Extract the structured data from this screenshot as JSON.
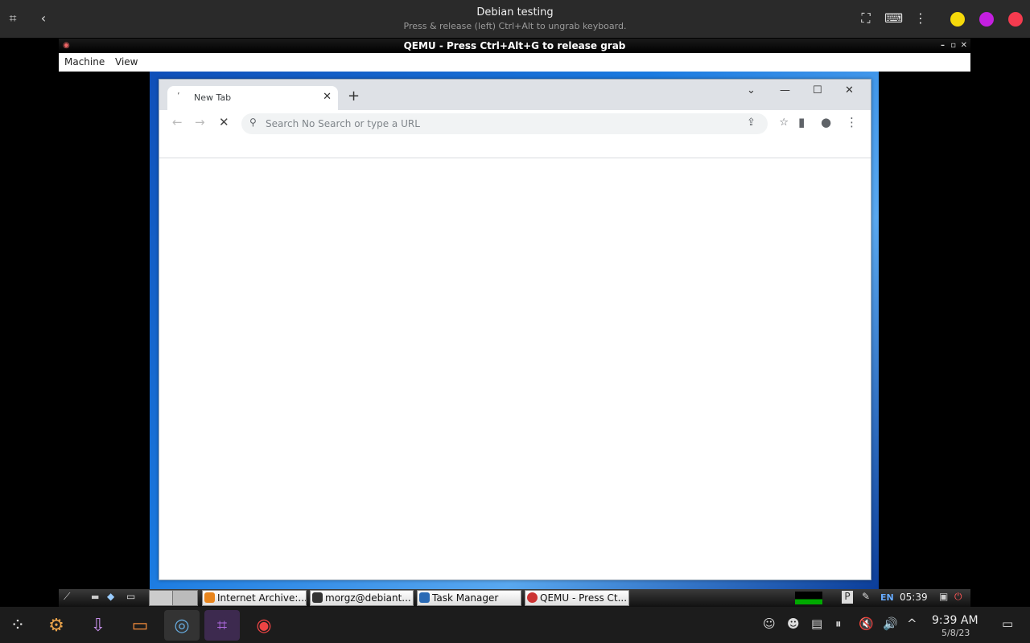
{
  "host": {
    "title": "Debian testing",
    "subtitle": "Press & release (left) Ctrl+Alt to ungrab keyboard.",
    "dot_colors": [
      "#f5d90a",
      "#c41fe0",
      "#f53b4f"
    ],
    "time": "9:39 AM",
    "date": "5/8/23"
  },
  "qemu": {
    "title": "QEMU - Press Ctrl+Alt+G to release grab",
    "menu": [
      "Machine",
      "View"
    ]
  },
  "browser": {
    "tab_title": "New Tab",
    "omnibox_placeholder": "Search No Search or type a URL"
  },
  "guest_taskbar": {
    "tasks": [
      "Internet Archive:...",
      "morgz@debiant...",
      "Task Manager",
      "QEMU - Press Ct..."
    ],
    "lang": "EN",
    "clock": "05:39"
  }
}
